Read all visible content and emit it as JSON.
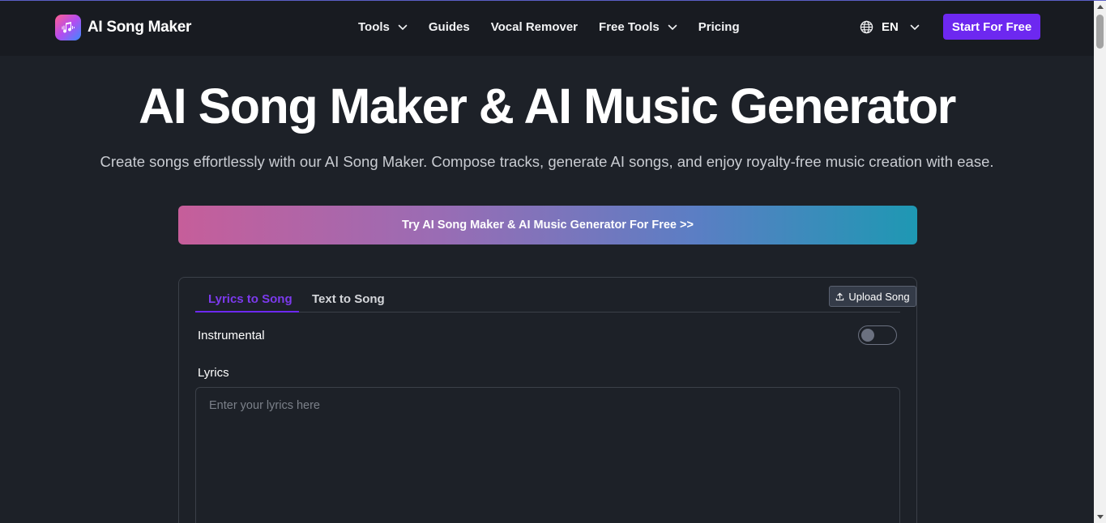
{
  "header": {
    "logo_text": "AI Song Maker",
    "nav": [
      {
        "label": "Tools",
        "has_dropdown": true
      },
      {
        "label": "Guides",
        "has_dropdown": false
      },
      {
        "label": "Vocal Remover",
        "has_dropdown": false
      },
      {
        "label": "Free Tools",
        "has_dropdown": true
      },
      {
        "label": "Pricing",
        "has_dropdown": false
      }
    ],
    "language": "EN",
    "cta_label": "Start For Free"
  },
  "hero": {
    "title": "AI Song Maker & AI Music Generator",
    "subtitle": "Create songs effortlessly with our AI Song Maker. Compose tracks, generate AI songs, and enjoy royalty-free music creation with ease.",
    "banner_label": "Try AI Song Maker & AI Music Generator For Free >>"
  },
  "form": {
    "tabs": [
      {
        "label": "Lyrics to Song",
        "active": true
      },
      {
        "label": "Text to Song",
        "active": false
      }
    ],
    "upload_label": "Upload Song",
    "instrumental_label": "Instrumental",
    "instrumental_on": false,
    "lyrics_label": "Lyrics",
    "lyrics_value": "",
    "lyrics_placeholder": "Enter your lyrics here"
  },
  "colors": {
    "accent": "#6d28f0",
    "background": "#1d2128",
    "header_bg": "#181b21"
  },
  "icons": [
    "music-note-icon",
    "chevron-down-icon",
    "globe-icon",
    "upload-icon"
  ]
}
